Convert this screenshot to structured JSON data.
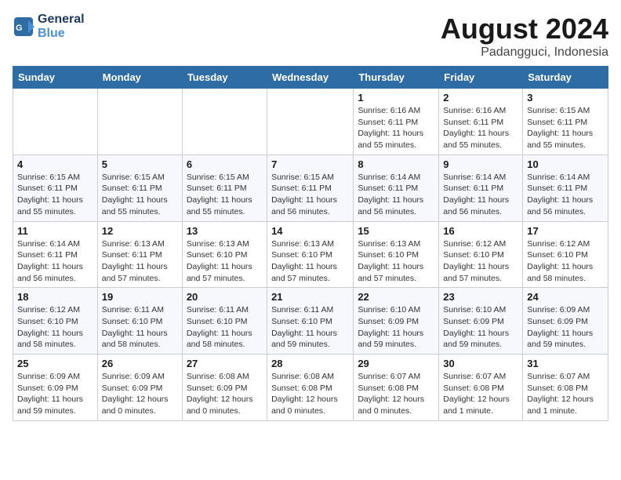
{
  "header": {
    "logo_line1": "General",
    "logo_line2": "Blue",
    "title": "August 2024",
    "subtitle": "Padangguci, Indonesia"
  },
  "weekdays": [
    "Sunday",
    "Monday",
    "Tuesday",
    "Wednesday",
    "Thursday",
    "Friday",
    "Saturday"
  ],
  "weeks": [
    [
      {
        "day": "",
        "detail": ""
      },
      {
        "day": "",
        "detail": ""
      },
      {
        "day": "",
        "detail": ""
      },
      {
        "day": "",
        "detail": ""
      },
      {
        "day": "1",
        "detail": "Sunrise: 6:16 AM\nSunset: 6:11 PM\nDaylight: 11 hours\nand 55 minutes."
      },
      {
        "day": "2",
        "detail": "Sunrise: 6:16 AM\nSunset: 6:11 PM\nDaylight: 11 hours\nand 55 minutes."
      },
      {
        "day": "3",
        "detail": "Sunrise: 6:15 AM\nSunset: 6:11 PM\nDaylight: 11 hours\nand 55 minutes."
      }
    ],
    [
      {
        "day": "4",
        "detail": "Sunrise: 6:15 AM\nSunset: 6:11 PM\nDaylight: 11 hours\nand 55 minutes."
      },
      {
        "day": "5",
        "detail": "Sunrise: 6:15 AM\nSunset: 6:11 PM\nDaylight: 11 hours\nand 55 minutes."
      },
      {
        "day": "6",
        "detail": "Sunrise: 6:15 AM\nSunset: 6:11 PM\nDaylight: 11 hours\nand 55 minutes."
      },
      {
        "day": "7",
        "detail": "Sunrise: 6:15 AM\nSunset: 6:11 PM\nDaylight: 11 hours\nand 56 minutes."
      },
      {
        "day": "8",
        "detail": "Sunrise: 6:14 AM\nSunset: 6:11 PM\nDaylight: 11 hours\nand 56 minutes."
      },
      {
        "day": "9",
        "detail": "Sunrise: 6:14 AM\nSunset: 6:11 PM\nDaylight: 11 hours\nand 56 minutes."
      },
      {
        "day": "10",
        "detail": "Sunrise: 6:14 AM\nSunset: 6:11 PM\nDaylight: 11 hours\nand 56 minutes."
      }
    ],
    [
      {
        "day": "11",
        "detail": "Sunrise: 6:14 AM\nSunset: 6:11 PM\nDaylight: 11 hours\nand 56 minutes."
      },
      {
        "day": "12",
        "detail": "Sunrise: 6:13 AM\nSunset: 6:11 PM\nDaylight: 11 hours\nand 57 minutes."
      },
      {
        "day": "13",
        "detail": "Sunrise: 6:13 AM\nSunset: 6:10 PM\nDaylight: 11 hours\nand 57 minutes."
      },
      {
        "day": "14",
        "detail": "Sunrise: 6:13 AM\nSunset: 6:10 PM\nDaylight: 11 hours\nand 57 minutes."
      },
      {
        "day": "15",
        "detail": "Sunrise: 6:13 AM\nSunset: 6:10 PM\nDaylight: 11 hours\nand 57 minutes."
      },
      {
        "day": "16",
        "detail": "Sunrise: 6:12 AM\nSunset: 6:10 PM\nDaylight: 11 hours\nand 57 minutes."
      },
      {
        "day": "17",
        "detail": "Sunrise: 6:12 AM\nSunset: 6:10 PM\nDaylight: 11 hours\nand 58 minutes."
      }
    ],
    [
      {
        "day": "18",
        "detail": "Sunrise: 6:12 AM\nSunset: 6:10 PM\nDaylight: 11 hours\nand 58 minutes."
      },
      {
        "day": "19",
        "detail": "Sunrise: 6:11 AM\nSunset: 6:10 PM\nDaylight: 11 hours\nand 58 minutes."
      },
      {
        "day": "20",
        "detail": "Sunrise: 6:11 AM\nSunset: 6:10 PM\nDaylight: 11 hours\nand 58 minutes."
      },
      {
        "day": "21",
        "detail": "Sunrise: 6:11 AM\nSunset: 6:10 PM\nDaylight: 11 hours\nand 59 minutes."
      },
      {
        "day": "22",
        "detail": "Sunrise: 6:10 AM\nSunset: 6:09 PM\nDaylight: 11 hours\nand 59 minutes."
      },
      {
        "day": "23",
        "detail": "Sunrise: 6:10 AM\nSunset: 6:09 PM\nDaylight: 11 hours\nand 59 minutes."
      },
      {
        "day": "24",
        "detail": "Sunrise: 6:09 AM\nSunset: 6:09 PM\nDaylight: 11 hours\nand 59 minutes."
      }
    ],
    [
      {
        "day": "25",
        "detail": "Sunrise: 6:09 AM\nSunset: 6:09 PM\nDaylight: 11 hours\nand 59 minutes."
      },
      {
        "day": "26",
        "detail": "Sunrise: 6:09 AM\nSunset: 6:09 PM\nDaylight: 12 hours\nand 0 minutes."
      },
      {
        "day": "27",
        "detail": "Sunrise: 6:08 AM\nSunset: 6:09 PM\nDaylight: 12 hours\nand 0 minutes."
      },
      {
        "day": "28",
        "detail": "Sunrise: 6:08 AM\nSunset: 6:08 PM\nDaylight: 12 hours\nand 0 minutes."
      },
      {
        "day": "29",
        "detail": "Sunrise: 6:07 AM\nSunset: 6:08 PM\nDaylight: 12 hours\nand 0 minutes."
      },
      {
        "day": "30",
        "detail": "Sunrise: 6:07 AM\nSunset: 6:08 PM\nDaylight: 12 hours\nand 1 minute."
      },
      {
        "day": "31",
        "detail": "Sunrise: 6:07 AM\nSunset: 6:08 PM\nDaylight: 12 hours\nand 1 minute."
      }
    ]
  ]
}
